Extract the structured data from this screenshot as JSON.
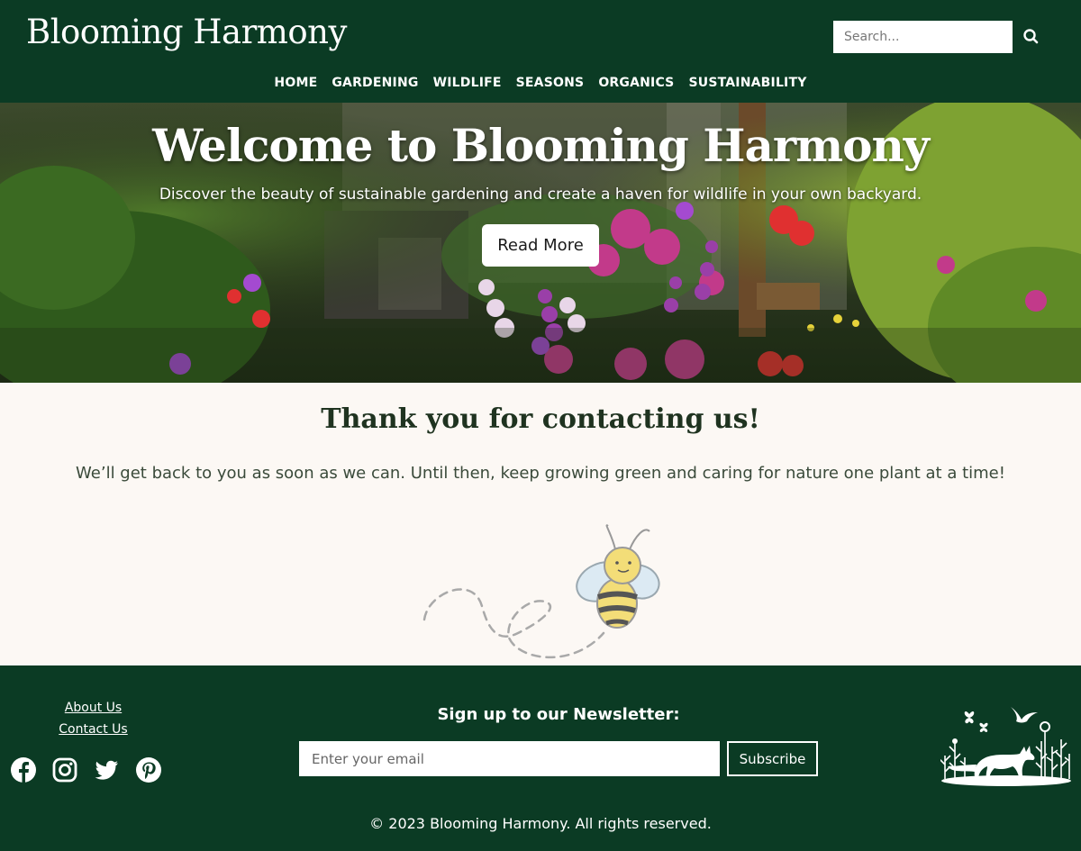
{
  "header": {
    "logo": "Blooming Harmony",
    "search_placeholder": "Search...",
    "nav": [
      "HOME",
      "GARDENING",
      "WILDLIFE",
      "SEASONS",
      "ORGANICS",
      "SUSTAINABILITY"
    ]
  },
  "hero": {
    "title": "Welcome to Blooming Harmony",
    "subtitle": "Discover the beauty of sustainable gardening and create a haven for wildlife in your own backyard.",
    "button_label": "Read More"
  },
  "main": {
    "title": "Thank you for contacting us!",
    "message": "We’ll get back to you as soon as we can. Until then, keep growing green and caring for nature one plant at a time!"
  },
  "footer": {
    "links": [
      "About Us",
      "Contact Us"
    ],
    "social_icons": [
      "facebook-icon",
      "instagram-icon",
      "twitter-icon",
      "pinterest-icon"
    ],
    "newsletter_title": "Sign up to our Newsletter:",
    "email_placeholder": "Enter your email",
    "subscribe_label": "Subscribe",
    "copyright": "© 2023 Blooming Harmony. All rights reserved."
  },
  "colors": {
    "brand_green": "#0b3b24",
    "background": "#fcf8f4",
    "text": "#2d3a2d"
  }
}
